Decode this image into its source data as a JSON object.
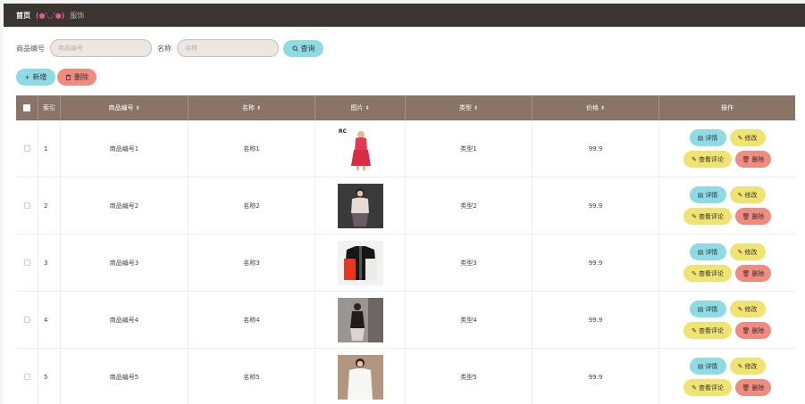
{
  "breadcrumb": {
    "home": "首页",
    "face": "(●'◡'●)",
    "current": "服饰"
  },
  "search": {
    "code_label": "商品编号",
    "code_placeholder": "商品编号",
    "name_label": "名称",
    "name_placeholder": "名称",
    "query_label": "查询"
  },
  "actions": {
    "add_label": "新增",
    "delete_label": "删除"
  },
  "table": {
    "headers": {
      "index": "索引",
      "code": "商品编号",
      "name": "名称",
      "image": "图片",
      "type": "类型",
      "price": "价格",
      "ops": "操作"
    },
    "row_buttons": {
      "detail": "详情",
      "edit": "修改",
      "review": "查看评论",
      "remove": "删除"
    },
    "rows": [
      {
        "index": "1",
        "code": "商品编号1",
        "name": "名称1",
        "type": "类型1",
        "price": "99.9",
        "image_logo": "RC"
      },
      {
        "index": "2",
        "code": "商品编号2",
        "name": "名称2",
        "type": "类型2",
        "price": "99.9"
      },
      {
        "index": "3",
        "code": "商品编号3",
        "name": "名称3",
        "type": "类型3",
        "price": "99.9"
      },
      {
        "index": "4",
        "code": "商品编号4",
        "name": "名称4",
        "type": "类型4",
        "price": "99.9"
      },
      {
        "index": "5",
        "code": "商品编号5",
        "name": "名称5",
        "type": "类型5",
        "price": "99.9"
      }
    ]
  },
  "colors": {
    "topbar": "#3b3531",
    "header": "#8a7367",
    "cyan": "#8fdbe5",
    "yellow": "#efe372",
    "salmon": "#f08b80"
  }
}
